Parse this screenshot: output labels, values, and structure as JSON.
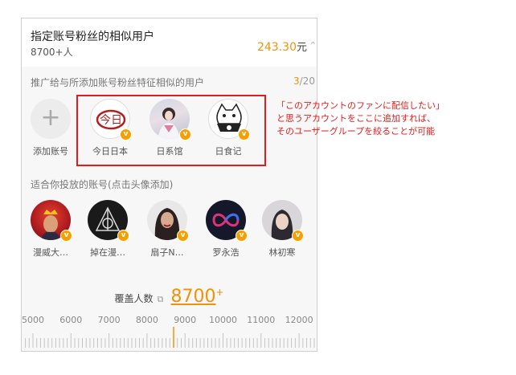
{
  "header": {
    "title": "指定账号粉丝的相似用户",
    "subtitle": "8700+人",
    "price": "243.30",
    "price_unit": "元"
  },
  "promo": {
    "label": "推广给与所添加账号粉丝特征相似的用户",
    "count_current": "3",
    "count_total": "/20"
  },
  "selected": {
    "add_label": "添加账号",
    "accounts": [
      {
        "name": "今日日本",
        "icon": "jinri-logo"
      },
      {
        "name": "日系馆",
        "icon": "girl-photo"
      },
      {
        "name": "日食记",
        "icon": "cat-logo"
      }
    ]
  },
  "suggested": {
    "label": "适合你投放的账号(点击头像添加)",
    "accounts": [
      {
        "name": "漫威大…"
      },
      {
        "name": "掉在漫…"
      },
      {
        "name": "扇子N…"
      },
      {
        "name": "罗永浩"
      },
      {
        "name": "林初寒"
      }
    ]
  },
  "coverage": {
    "label": "覆盖人数",
    "value": "8700",
    "plus": "+",
    "slider_value": 8700
  },
  "ruler": {
    "ticks": [
      "5000",
      "6000",
      "7000",
      "8000",
      "9000",
      "10000",
      "11000",
      "12000"
    ]
  },
  "annotation": {
    "line1": "「このアカウントのファンに配信したい」",
    "line2": "と思うアカウントをここに追加すれば、",
    "line3": "そのユーザーグループを絞ることが可能"
  },
  "colors": {
    "accent": "#f0920a",
    "badge": "#f5a000",
    "annotation": "#e21b1b"
  }
}
